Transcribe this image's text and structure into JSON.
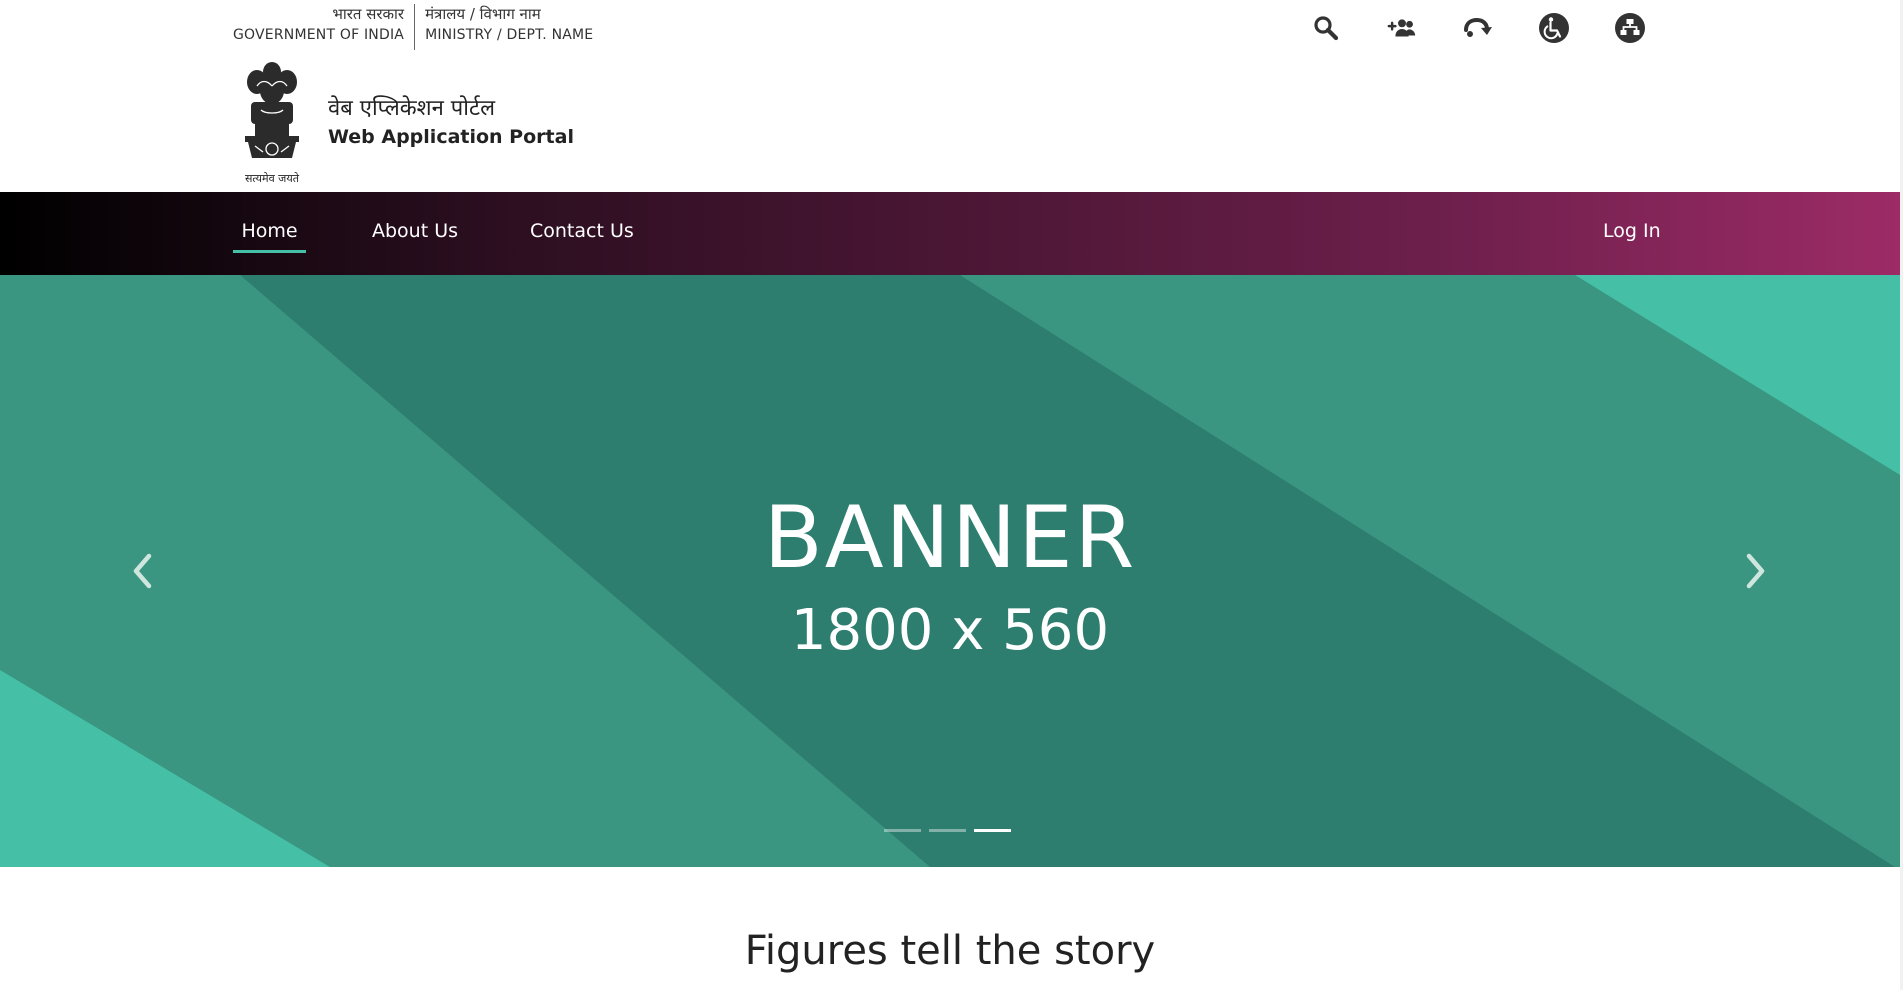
{
  "top_bar": {
    "gov_hindi": "भारत सरकार",
    "gov_english": "GOVERNMENT OF INDIA",
    "ministry_hindi": "मंत्रालय / विभाग नाम",
    "ministry_english": "MINISTRY / DEPT. NAME"
  },
  "utility_icons": [
    "search-icon",
    "social-icon",
    "skip-to-content-icon",
    "accessibility-icon",
    "sitemap-icon"
  ],
  "branding": {
    "emblem_caption": "सत्यमेव जयते",
    "portal_hindi": "वेब एप्लिकेशन पोर्टल",
    "portal_english": "Web Application Portal"
  },
  "nav": {
    "items": [
      {
        "label": "Home",
        "active": true
      },
      {
        "label": "About Us",
        "active": false
      },
      {
        "label": "Contact Us",
        "active": false
      }
    ],
    "login_label": "Log In",
    "gradient_colors": [
      "#000000",
      "#9c2b66"
    ],
    "active_underline_color": "#45bfa6"
  },
  "banner": {
    "title": "BANNER",
    "subtitle": "1800 x 560",
    "slide_count": 3,
    "active_slide": 3,
    "colors": [
      "#2e7e6f",
      "#3a9680",
      "#45bfa6"
    ]
  },
  "section": {
    "title": "Figures tell the story"
  }
}
